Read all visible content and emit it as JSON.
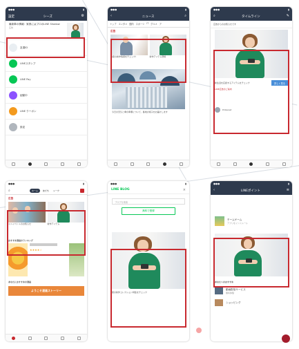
{
  "screen1": {
    "header_title": "シーズ",
    "header_left": "設定",
    "ad_text": "最新車の情報：家具にはプロのLINE Shadow",
    "ad_sub": "広告",
    "rows": [
      {
        "title": "友達ID",
        "sub": "",
        "color": "#e9eef2"
      },
      {
        "title": "LINEスタンプ",
        "sub": "",
        "color": "#06c755"
      },
      {
        "title": "LINE Pay",
        "sub": "",
        "color": "#06c755"
      },
      {
        "title": "起動中",
        "sub": "",
        "color": "#8c52ff"
      },
      {
        "title": "LINE クーポン",
        "sub": "",
        "color": "#f39a1e"
      },
      {
        "title": "設定",
        "sub": "",
        "color": "#b0b6bd"
      }
    ]
  },
  "screen2": {
    "header_title": "ニュース",
    "tabs": [
      "トップ",
      "エンタメ",
      "国内",
      "スポーツ",
      "IT",
      "グルメ",
      "ア"
    ],
    "ad_label": "広告",
    "ad_caption_left": "春夏の新作情報をチェック！",
    "ad_caption_right": "新作アイテム登場",
    "article_caption": "今日の天気と傘の準備について、各地の様子をお届けします"
  },
  "screen3": {
    "header_title": "タイムライン",
    "notice": "広告からのお知らせです",
    "ad_caption": "新生活を応援するアイテムをチェック",
    "ad_button": "詳しく見る",
    "ad_sub": "LINE広告のご案内",
    "user_name": "Pinterest"
  },
  "screen4": {
    "tabs": [
      "ホーム",
      "友だち",
      "トーク"
    ],
    "ad_label": "広告",
    "ad_caption_left": "ミニイベントのお知らせ",
    "ad_caption_right": "新作アイテム",
    "section_title": "おすすめ漫画のランキング",
    "rating": "★★★★☆",
    "section2_title": "あなたにおすすめの漫画",
    "banner": "ようこそ漫画ストーリー"
  },
  "screen5": {
    "logo": "LINE BLOG",
    "search_placeholder": "ブログを検索",
    "login_button": "無料で登録",
    "caption": "夏の新作コレクション特集をチェック"
  },
  "screen6": {
    "header_title": "LINEポイント",
    "item1": "チームゲーム",
    "item1_sub": "アプリをインストール",
    "section_title": "あなたへのおすすめ",
    "item2": "動画配信サービス",
    "item2_sub": "無料体験",
    "item3": "ショッピング"
  }
}
